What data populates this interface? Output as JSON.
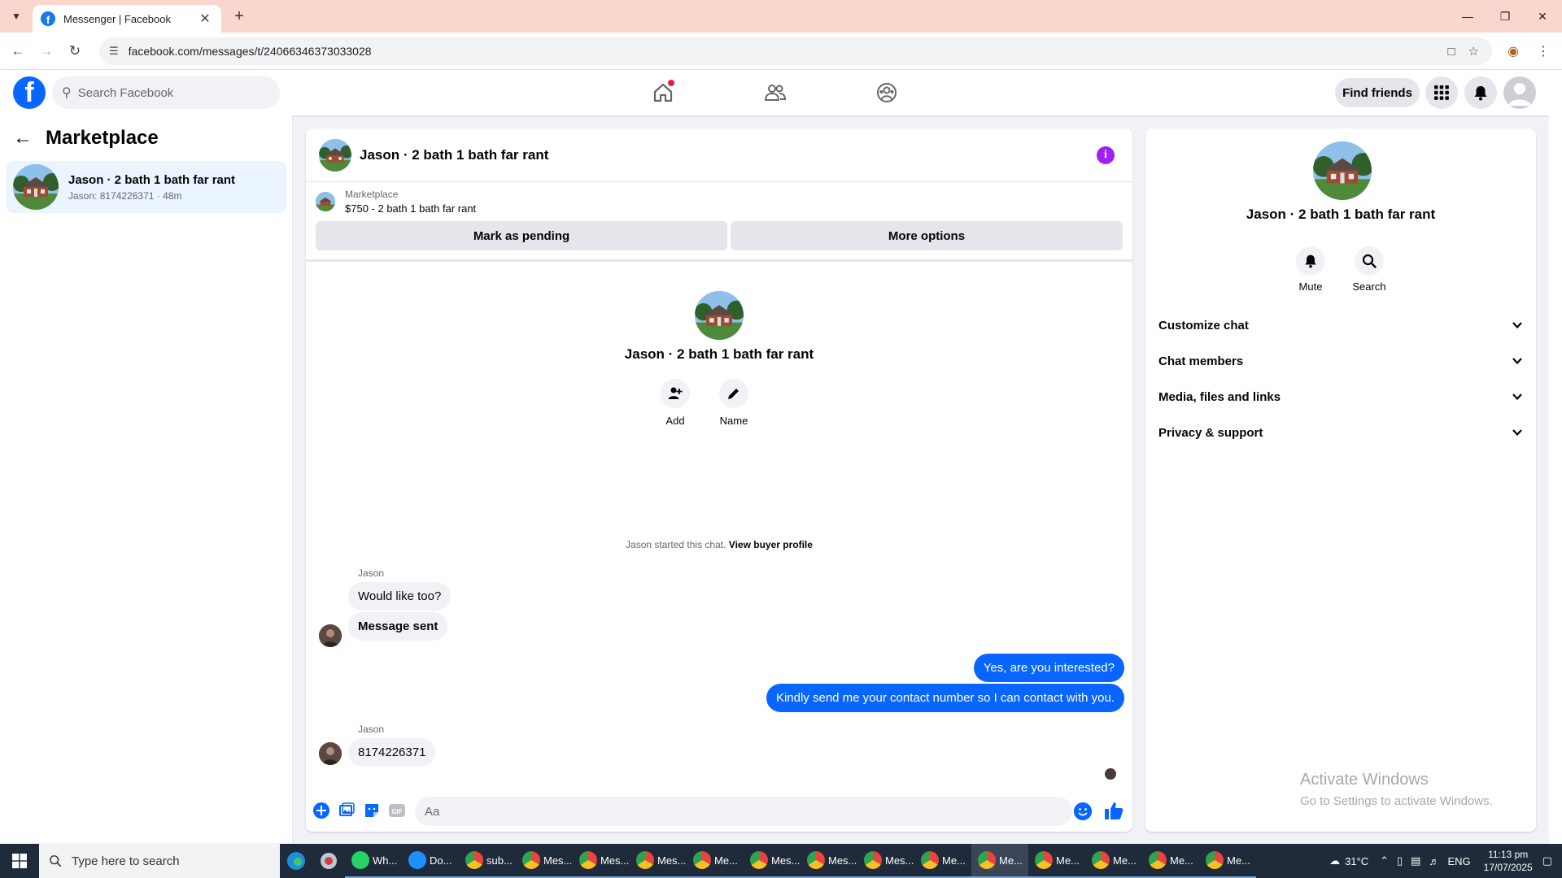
{
  "browser": {
    "tab_title": "Messenger | Facebook",
    "url": "facebook.com/messages/t/24066346373033028",
    "new_tab_symbol": "+"
  },
  "fb_nav": {
    "search_placeholder": "Search Facebook",
    "find_friends_label": "Find friends",
    "brand_color": "#0866ff"
  },
  "sidebar": {
    "title": "Marketplace",
    "conversations": [
      {
        "name": "Jason · 2 bath 1 bath far rant",
        "preview": "Jason: 8174226371 · 48m"
      }
    ]
  },
  "chat": {
    "header_name": "Jason · 2 bath 1 bath far rant",
    "marketplace_label": "Marketplace",
    "listing": "$750 - 2 bath 1 bath far rant",
    "mark_pending_label": "Mark as pending",
    "more_options_label": "More options",
    "intro_name": "Jason · 2 bath 1 bath far rant",
    "add_label": "Add",
    "name_label": "Name",
    "started_text": "Jason started this chat.",
    "view_profile_label": "View buyer profile",
    "messages": [
      {
        "sender": "Jason",
        "text": "Would like too?",
        "direction": "in"
      },
      {
        "sender": "",
        "text": "Message sent",
        "direction": "in"
      },
      {
        "sender": "",
        "text": "Yes, are you interested?",
        "direction": "out"
      },
      {
        "sender": "",
        "text": "Kindly send me your contact number so I can contact with you.",
        "direction": "out"
      },
      {
        "sender": "Jason",
        "text": "8174226371",
        "direction": "in"
      }
    ],
    "composer_placeholder": "Aa",
    "gif_label": "GIF",
    "outgoing_color": "#0866ff"
  },
  "details": {
    "name": "Jason · 2 bath 1 bath far rant",
    "mute_label": "Mute",
    "search_label": "Search",
    "sections": [
      "Customize chat",
      "Chat members",
      "Media, files and links",
      "Privacy & support"
    ],
    "watermark_title": "Activate Windows",
    "watermark_sub": "Go to Settings to activate Windows."
  },
  "taskbar": {
    "search_placeholder": "Type here to search",
    "items": [
      {
        "label": "Wh...",
        "icon": "whatsapp-icon",
        "color": "#25d366"
      },
      {
        "label": "Do...",
        "icon": "download-icon",
        "color": "#1e90ff"
      },
      {
        "label": "sub...",
        "icon": "chrome-icon",
        "color": "#e8453c"
      },
      {
        "label": "Mes...",
        "icon": "chrome-icon",
        "color": "#e8453c"
      },
      {
        "label": "Mes...",
        "icon": "chrome-icon",
        "color": "#e8453c"
      },
      {
        "label": "Mes...",
        "icon": "chrome-icon",
        "color": "#e8453c"
      },
      {
        "label": "Me...",
        "icon": "chrome-icon",
        "color": "#e8453c"
      },
      {
        "label": "Mes...",
        "icon": "chrome-icon",
        "color": "#e8453c"
      },
      {
        "label": "Mes...",
        "icon": "chrome-icon",
        "color": "#e8453c"
      },
      {
        "label": "Mes...",
        "icon": "chrome-icon",
        "color": "#e8453c"
      },
      {
        "label": "Me...",
        "icon": "chrome-icon",
        "color": "#e8453c"
      },
      {
        "label": "Me...",
        "icon": "chrome-icon",
        "color": "#e8453c"
      },
      {
        "label": "Me...",
        "icon": "chrome-icon",
        "color": "#e8453c"
      },
      {
        "label": "Me...",
        "icon": "chrome-icon",
        "color": "#e8453c"
      },
      {
        "label": "Me...",
        "icon": "chrome-icon",
        "color": "#e8453c"
      },
      {
        "label": "Me...",
        "icon": "chrome-icon",
        "color": "#e8453c"
      }
    ],
    "active_index": 11,
    "temperature": "31°C",
    "language": "ENG",
    "time": "11:13 pm",
    "date": "17/07/2025"
  }
}
